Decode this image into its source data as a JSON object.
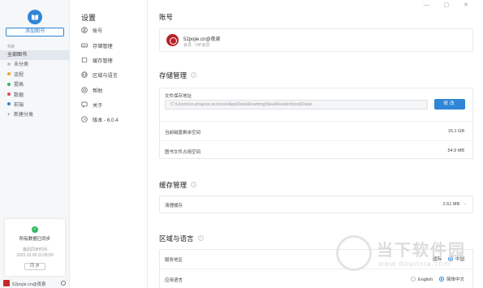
{
  "sidebar": {
    "add_book": "添加图书",
    "section_label": "书架",
    "items": [
      {
        "label": "全部图书",
        "dot": "",
        "active": true
      },
      {
        "label": "未分类",
        "dot": "#bfc5cc"
      },
      {
        "label": "流程",
        "dot": "#f0a630"
      },
      {
        "label": "提高",
        "dot": "#2fb95e"
      },
      {
        "label": "数据",
        "dot": "#e34b4b"
      },
      {
        "label": "前端",
        "dot": "#2f86d6"
      },
      {
        "label": "新建分类",
        "plus": true
      }
    ],
    "sync": {
      "title": "所有数据已同步",
      "subtitle": "最后同步时间",
      "time": "2020.10.09 11:05:50",
      "button": "同 步"
    },
    "user": "52pojie.cn@夜泉"
  },
  "settings_nav": {
    "title": "设置",
    "items": [
      {
        "label": "账号",
        "icon": "user-icon"
      },
      {
        "label": "存储管理",
        "icon": "storage-icon"
      },
      {
        "label": "缓存管理",
        "icon": "cache-icon"
      },
      {
        "label": "区域与语言",
        "icon": "globe-icon"
      },
      {
        "label": "帮助",
        "icon": "help-icon"
      },
      {
        "label": "关于",
        "icon": "about-icon"
      },
      {
        "label": "版本 - 6.0.4",
        "icon": "version-icon"
      }
    ]
  },
  "window": {
    "controls": "— ▢ ✕"
  },
  "account": {
    "heading": "账号",
    "name": "52pojie.cn@夜泉",
    "level": "会员 · VIP会员"
  },
  "storage": {
    "heading": "存储管理",
    "path_label": "文件保存地址",
    "path_value": "C:\\Users\\cn.pnapus.services\\AppData\\Roaming\\NeatReader\\bookData\\",
    "modify": "修改",
    "free_label": "当前磁盘剩余空间",
    "free_value": "15.1 GB",
    "used_label": "图书文件占用空间",
    "used_value": "54.9 MB"
  },
  "cache": {
    "heading": "缓存管理",
    "clear_label": "清理缓存",
    "clear_value": "2.61 MB"
  },
  "region": {
    "heading": "区域与语言",
    "area_label": "服务地区",
    "area_opt1": "国际",
    "area_opt2": "中国",
    "lang_label": "应用语言",
    "lang_opt1": "English",
    "lang_opt2": "简体中文"
  },
  "watermark": {
    "text1": "当下软件园",
    "text2": "www.downxia.com"
  },
  "colors": {
    "accent": "#2f86d6",
    "sync_ok": "#2fb95e"
  }
}
